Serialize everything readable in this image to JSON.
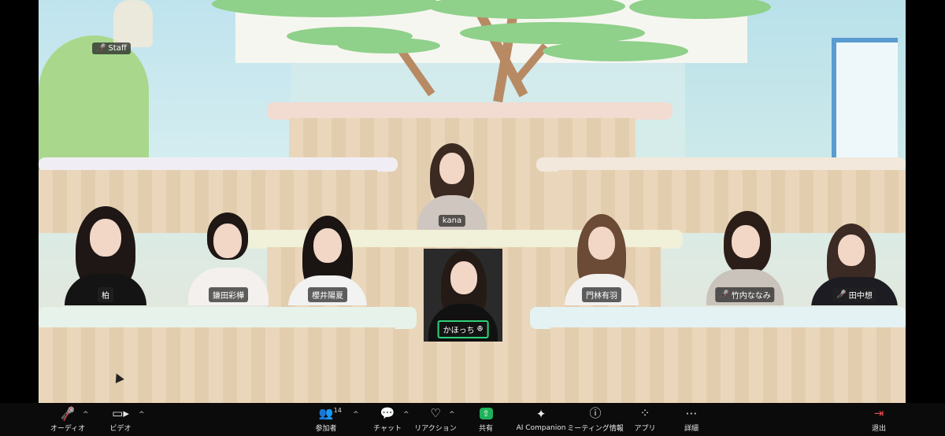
{
  "scene": {
    "background": "immersive-classroom-tree"
  },
  "staff": {
    "name": "Staff",
    "mic_icon": "mic-muted-icon"
  },
  "participants": [
    {
      "name": "kana",
      "muted": false,
      "active": false
    },
    {
      "name": "柏",
      "muted": false,
      "active": false
    },
    {
      "name": "鎌田彩樺",
      "muted": false,
      "active": false
    },
    {
      "name": "櫻井陽夏",
      "muted": false,
      "active": false
    },
    {
      "name": "かほっち",
      "muted": false,
      "active": true,
      "badge": "ꔮ"
    },
    {
      "name": "門林有羽",
      "muted": false,
      "active": false
    },
    {
      "name": "竹内ななみ",
      "muted": true,
      "active": false
    },
    {
      "name": "田中想",
      "muted": true,
      "active": false
    }
  ],
  "toolbar": {
    "audio": {
      "label": "オーディオ",
      "icon": "mic-muted-icon"
    },
    "video": {
      "label": "ビデオ",
      "icon": "video-camera-icon"
    },
    "participants": {
      "label": "参加者",
      "count": "14",
      "icon": "participants-icon"
    },
    "chat": {
      "label": "チャット",
      "icon": "chat-icon"
    },
    "reactions": {
      "label": "リアクション",
      "icon": "heart-icon"
    },
    "share": {
      "label": "共有",
      "icon": "share-screen-icon"
    },
    "ai": {
      "label": "AI Companion",
      "icon": "sparkle-icon"
    },
    "info": {
      "label": "ミーティング情報",
      "icon": "info-icon"
    },
    "apps": {
      "label": "アプリ",
      "icon": "apps-icon"
    },
    "more": {
      "label": "詳細",
      "icon": "more-icon"
    },
    "leave": {
      "label": "退出",
      "icon": "leave-icon"
    }
  },
  "colors": {
    "accent_green": "#2ed37a",
    "share_green": "#1fb15a",
    "leave_red": "#e5484d",
    "toolbar_bg": "#0b0b0b"
  }
}
